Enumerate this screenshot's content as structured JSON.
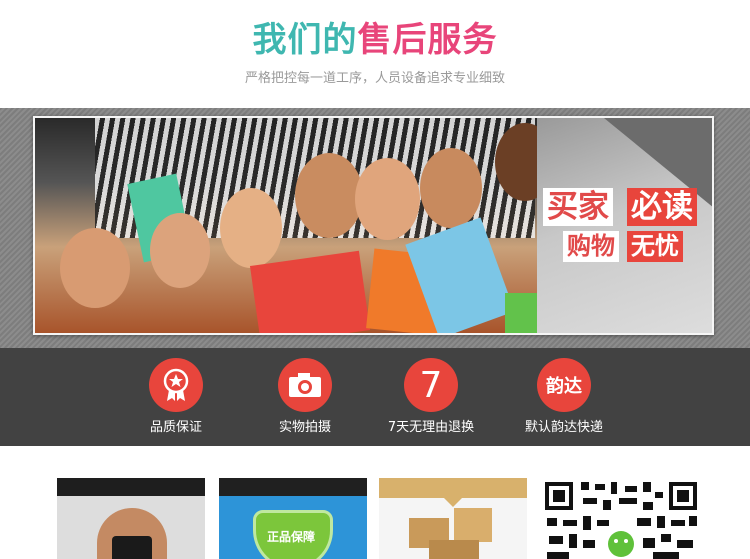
{
  "header": {
    "title_part1": "我们的",
    "title_part2": "售后服务",
    "subtitle": "严格把控每一道工序，人员设备追求专业细致"
  },
  "banner": {
    "tag_line1_left": "买家",
    "tag_line1_right": "必读",
    "tag_line2_left": "购物",
    "tag_line2_right": "无忧"
  },
  "features": [
    {
      "icon": "medal-icon",
      "label": "品质保证"
    },
    {
      "icon": "camera-icon",
      "label": "实物拍摄"
    },
    {
      "icon": "seven-icon",
      "icon_text": "7",
      "label": "7天无理由退换"
    },
    {
      "icon": "yunda-icon",
      "icon_text": "韵达",
      "label": "默认韵达快递"
    }
  ],
  "thumbnails": {
    "badge_text": "正品保障"
  },
  "colors": {
    "teal": "#3fb7b0",
    "pink": "#e8457a",
    "red": "#e8453c",
    "dark_strip": "#424242"
  }
}
